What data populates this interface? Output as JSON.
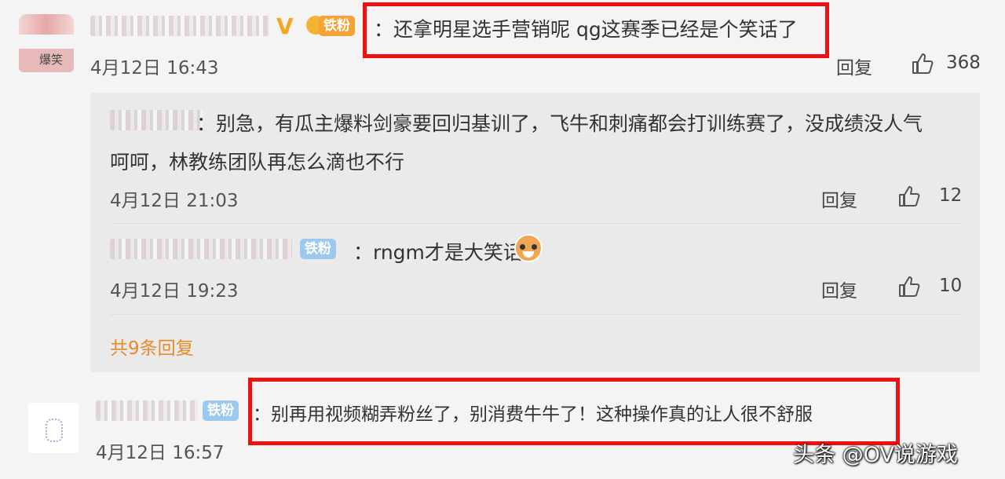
{
  "comments": [
    {
      "text": "：还拿明星选手营销呢 qg这赛季已经是个笑话了",
      "time": "4月12日 16:43",
      "reply_label": "回复",
      "likes": "368",
      "badge": "铁粉",
      "avatar_text": "爆笑"
    },
    {
      "text": "：别再用视频糊弄粉丝了，别消费牛牛了！这种操作真的让人很不舒服",
      "time": "4月12日 16:57",
      "badge": "铁粉"
    }
  ],
  "replies": [
    {
      "text_line1": "：别急，有瓜主爆料剑豪要回归基训了，飞牛和刺痛都会打训练赛了，没成绩没人气",
      "text_line2": "呵呵，林教练团队再怎么滴也不行",
      "time": "4月12日 21:03",
      "reply_label": "回复",
      "likes": "12"
    },
    {
      "badge": "铁粉",
      "text": "：rngm才是大笑话",
      "time": "4月12日 19:23",
      "reply_label": "回复",
      "likes": "10"
    }
  ],
  "more_replies": "共9条回复",
  "watermark": "头条 @OV说游戏",
  "colors": {
    "highlight": "#ee1111",
    "link": "#e8892b",
    "badge": "#9ec9ee"
  }
}
